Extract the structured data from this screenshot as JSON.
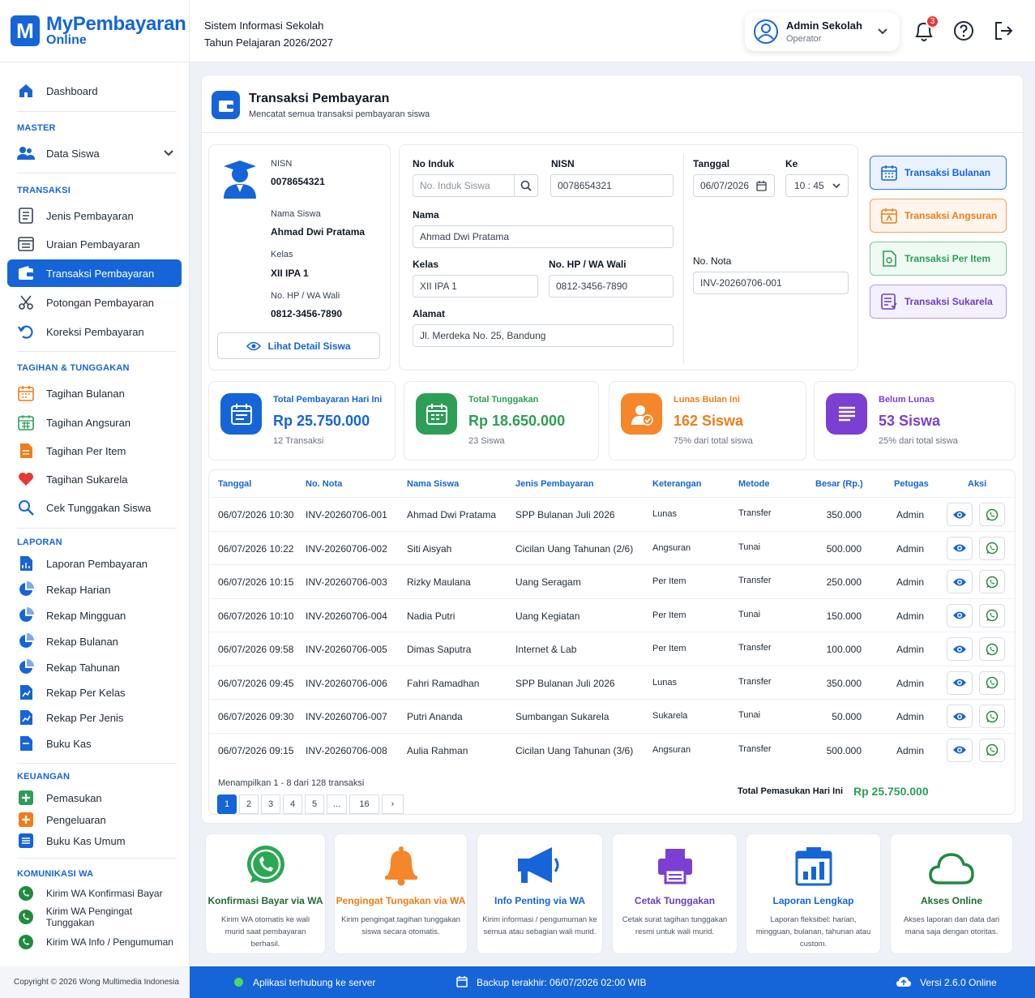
{
  "brand": {
    "logo_letter": "M",
    "name": "MyPembayaran",
    "sub": "Online"
  },
  "header": {
    "system_name": "Sistem Informasi Sekolah",
    "academic_year": "Tahun Pelajaran 2026/2027",
    "user_name": "Admin Sekolah",
    "user_role": "Operator",
    "notif_count": "3"
  },
  "sidebar": {
    "dashboard": "Dashboard",
    "sec_master": "MASTER",
    "data_siswa": "Data Siswa",
    "sec_transaksi": "TRANSAKSI",
    "jenis": "Jenis Pembayaran",
    "uraian": "Uraian Pembayaran",
    "transaksi": "Transaksi Pembayaran",
    "potongan": "Potongan Pembayaran",
    "koreksi": "Koreksi Pembayaran",
    "sec_tagihan": "TAGIHAN & TUNGGAKAN",
    "tag_bulanan": "Tagihan Bulanan",
    "tag_angsuran": "Tagihan Angsuran",
    "tag_item": "Tagihan Per Item",
    "tag_sukarela": "Tagihan Sukarela",
    "cek_tunggakan": "Cek Tunggakan Siswa",
    "sec_laporan": "LAPORAN",
    "lap_pembayaran": "Laporan Pembayaran",
    "rekap_harian": "Rekap Harian",
    "rekap_mingguan": "Rekap Mingguan",
    "rekap_bulanan": "Rekap Bulanan",
    "rekap_tahunan": "Rekap Tahunan",
    "rekap_kelas": "Rekap Per Kelas",
    "rekap_jenis": "Rekap Per Jenis",
    "buku_kas": "Buku Kas",
    "sec_keuangan": "KEUANGAN",
    "pemasukan": "Pemasukan",
    "pengeluaran": "Pengeluaran",
    "buku_kas_umum": "Buku Kas Umum",
    "sec_wa": "KOMUNIKASI WA",
    "wa_konfirmasi": "Kirim WA Konfirmasi Bayar",
    "wa_pengingat": "Kirim WA Pengingat Tunggakan",
    "wa_info": "Kirim WA Info / Pengumuman"
  },
  "page": {
    "title": "Transaksi Pembayaran",
    "subtitle": "Mencatat semua transaksi pembayaran siswa"
  },
  "student": {
    "nisn_label": "NISN",
    "nisn": "0078654321",
    "name_label": "Nama Siswa",
    "name": "Ahmad Dwi Pratama",
    "class_label": "Kelas",
    "class": "XII IPA 1",
    "phone_label": "No. HP / WA Wali",
    "phone": "0812-3456-7890",
    "detail_button": "Lihat Detail Siswa"
  },
  "form": {
    "no_induk_label": "No Induk",
    "no_induk_placeholder": "No. Induk Siswa",
    "nisn_label": "NISN",
    "nisn_value": "0078654321",
    "nama_label": "Nama",
    "nama_value": "Ahmad Dwi Pratama",
    "kelas_label": "Kelas",
    "kelas_value": "XII IPA 1",
    "hp_label": "No. HP / WA Wali",
    "hp_value": "0812-3456-7890",
    "alamat_label": "Alamat",
    "alamat_value": "Jl. Merdeka No. 25, Bandung",
    "tanggal_label": "Tanggal",
    "tanggal_value": "06/07/2026",
    "ke_label": "Ke",
    "ke_value": "10 : 45",
    "nota_label": "No. Nota",
    "nota_value": "INV-20260706-001"
  },
  "tx_buttons": [
    {
      "label": "Transaksi Bulanan",
      "color": "#1565d8",
      "icon": "calendar-icon"
    },
    {
      "label": "Transaksi Angsuran",
      "color": "#f07d1a",
      "icon": "calendar-icon"
    },
    {
      "label": "Transaksi Per Item",
      "color": "#2e9e57",
      "icon": "document-icon"
    },
    {
      "label": "Transaksi Sukarela",
      "color": "#6a3fc1",
      "icon": "list-icon"
    }
  ],
  "stats": [
    {
      "label": "Total Pembayaran Hari Ini",
      "value": "Rp 25.750.000",
      "note": "12 Transaksi",
      "color": "#1565d8"
    },
    {
      "label": "Total Tunggakan",
      "value": "Rp 18.650.000",
      "note": "23 Siswa",
      "color": "#2e9e57"
    },
    {
      "label": "Lunas Bulan Ini",
      "value": "162 Siswa",
      "note": "75% dari total siswa",
      "color": "#f07d1a"
    },
    {
      "label": "Belum Lunas",
      "value": "53 Siswa",
      "note": "25% dari total siswa",
      "color": "#7b3fd1"
    }
  ],
  "table": {
    "headers": [
      "Tanggal",
      "No. Nota",
      "Nama Siswa",
      "Jenis Pembayaran",
      "Keterangan",
      "Metode",
      "Besar (Rp.)",
      "Petugas",
      "Aksi"
    ],
    "rows": [
      [
        "06/07/2026 10:30",
        "INV-20260706-001",
        "Ahmad Dwi Pratama",
        "SPP Bulanan Juli 2026",
        "Lunas",
        "Transfer",
        "350.000",
        "Admin"
      ],
      [
        "06/07/2026 10:22",
        "INV-20260706-002",
        "Siti Aisyah",
        "Cicilan Uang Tahunan (2/6)",
        "Angsuran",
        "Tunai",
        "500.000",
        "Admin"
      ],
      [
        "06/07/2026 10:15",
        "INV-20260706-003",
        "Rizky Maulana",
        "Uang Seragam",
        "Per Item",
        "Transfer",
        "250.000",
        "Admin"
      ],
      [
        "06/07/2026 10:10",
        "INV-20260706-004",
        "Nadia Putri",
        "Uang Kegiatan",
        "Per Item",
        "Tunai",
        "150.000",
        "Admin"
      ],
      [
        "06/07/2026 09:58",
        "INV-20260706-005",
        "Dimas Saputra",
        "Internet & Lab",
        "Per Item",
        "Transfer",
        "100.000",
        "Admin"
      ],
      [
        "06/07/2026 09:45",
        "INV-20260706-006",
        "Fahri Ramadhan",
        "SPP Bulanan Juli 2026",
        "Lunas",
        "Transfer",
        "350.000",
        "Admin"
      ],
      [
        "06/07/2026 09:30",
        "INV-20260706-007",
        "Putri Ananda",
        "Sumbangan Sukarela",
        "Sukarela",
        "Tunai",
        "50.000",
        "Admin"
      ],
      [
        "06/07/2026 09:15",
        "INV-20260706-008",
        "Aulia Rahman",
        "Cicilan Uang Tahunan (3/6)",
        "Angsuran",
        "Transfer",
        "500.000",
        "Admin"
      ]
    ],
    "showing": "Menampilkan 1 - 8 dari 128 transaksi",
    "total_label": "Total Pemasukan Hari Ini",
    "total_value": "Rp 25.750.000",
    "pages": [
      "1",
      "2",
      "3",
      "4",
      "5",
      "...",
      "16",
      "›"
    ]
  },
  "features": [
    {
      "title": "Konfirmasi Bayar via WA",
      "desc": "Kirim WA otomatis ke wali murid saat pembayaran berhasil.",
      "color": "#1f8a3e",
      "icon": "whatsapp-icon"
    },
    {
      "title": "Pengingat Tungakan via WA",
      "desc": "Kirim pengingat tagihan tunggakan siswa secara otomatis.",
      "color": "#f07d1a",
      "icon": "bell-icon"
    },
    {
      "title": "Info Penting via WA",
      "desc": "Kirim informasi / pengumuman ke semua atau sebagian wali murid.",
      "color": "#1565d8",
      "icon": "megaphone-icon"
    },
    {
      "title": "Cetak Tunggakan",
      "desc": "Cetak surat tagihan tunggakan resmi untuk wali murid.",
      "color": "#7b3fd1",
      "icon": "printer-icon"
    },
    {
      "title": "Laporan Lengkap",
      "desc": "Laporan fleksibel: harian, mingguan, bulanan, tahunan atau custom.",
      "color": "#1565d8",
      "icon": "report-icon"
    },
    {
      "title": "Akses Online",
      "desc": "Akses laporan dan data dari mana saja dengan otoritas.",
      "color": "#1f8a3e",
      "icon": "cloud-icon"
    }
  ],
  "footer": {
    "copyright": "Copyright © 2026 Wong Multimedia Indonesia",
    "server": "Aplikasi terhubung ke server",
    "backup": "Backup terakhir: 06/07/2026 02:00 WIB",
    "version": "Versi 2.6.0 Online"
  }
}
